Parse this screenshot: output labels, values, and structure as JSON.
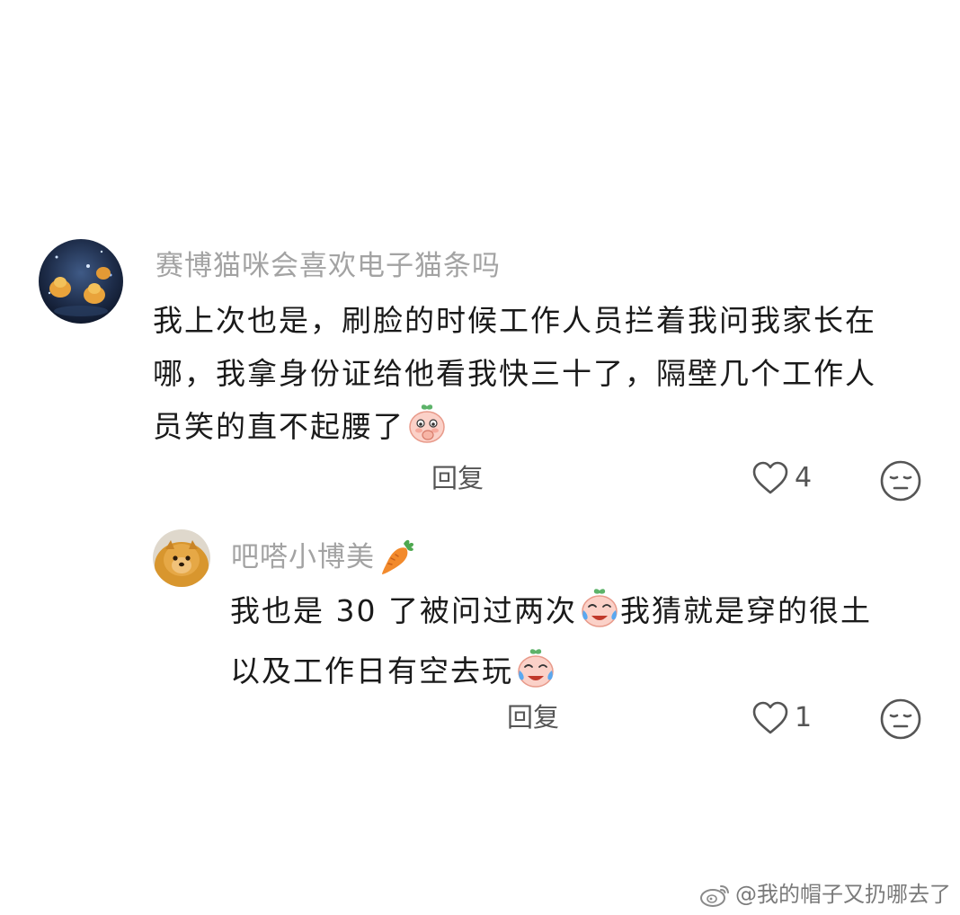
{
  "comment": {
    "username": "赛博猫咪会喜欢电子猫条吗",
    "lines": [
      "我上次也是，刷脸的时候工作人员拦着我问我家长在",
      "哪，我拿身份证给他看我快三十了，隔壁几个工作人",
      "员笑的直不起腰了"
    ],
    "emoji": "blush-cover-mouth",
    "reply_label": "回复",
    "like_count": "4"
  },
  "reply": {
    "username": "吧嗒小博美",
    "username_badge": "carrot-icon",
    "line1_part1": "我也是 30 了被问过两次",
    "line1_part2": "我猜就是穿的很土",
    "line2": "以及工作日有空去玩",
    "emoji": "laugh-cry",
    "reply_label": "回复",
    "like_count": "1"
  },
  "watermark": {
    "text": "@我的帽子又扔哪去了",
    "logo": "weibo-logo"
  },
  "colors": {
    "username": "#a3a3a3",
    "text": "#1a1a1a",
    "action": "#555555",
    "emoji_face": "#fbd1c8",
    "emoji_leaf": "#5db36a",
    "carrot": "#f28a2c"
  }
}
